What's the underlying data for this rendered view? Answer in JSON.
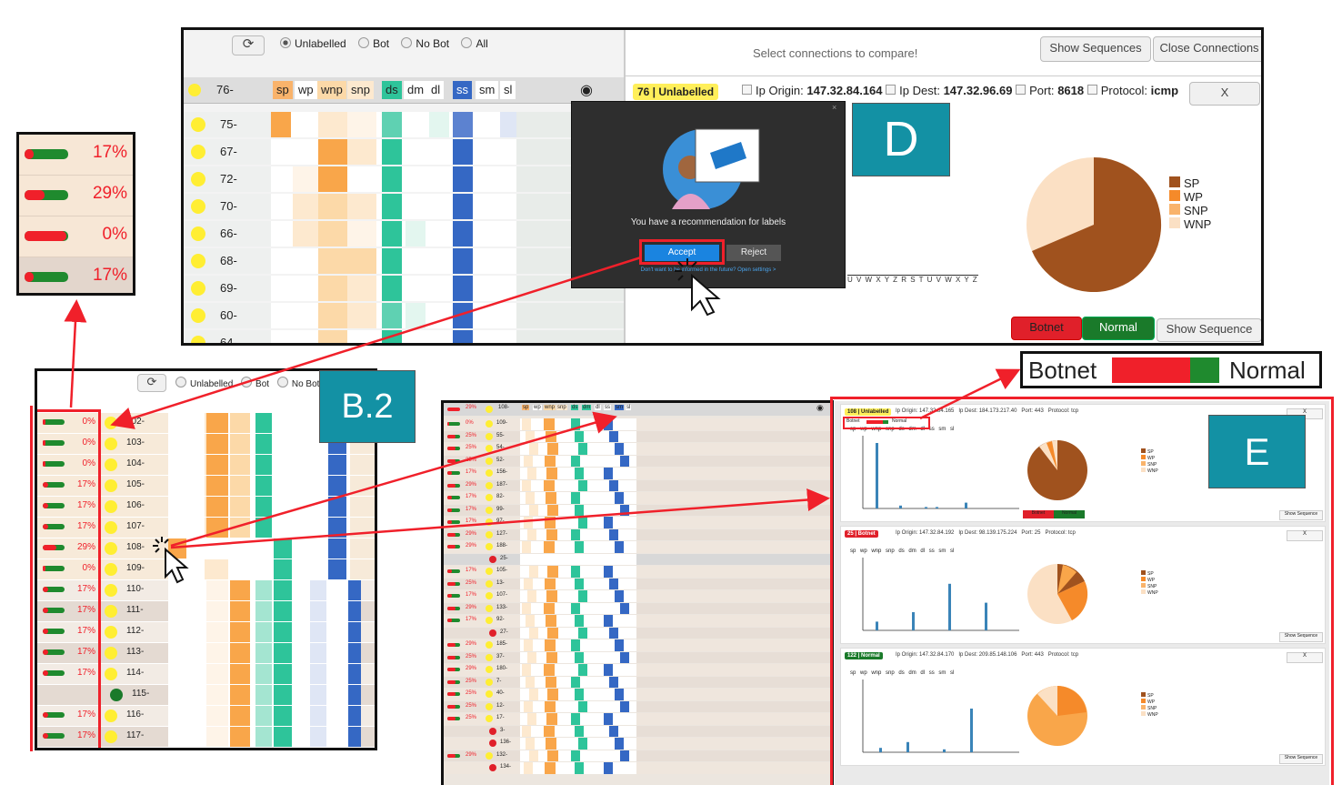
{
  "top_panel": {
    "refresh_icon": "refresh-icon",
    "filters": [
      {
        "label": "Unlabelled",
        "selected": true
      },
      {
        "label": "Bot",
        "selected": false
      },
      {
        "label": "No Bot",
        "selected": false
      },
      {
        "label": "All",
        "selected": false
      }
    ],
    "select_hint": "Select connections to compare!",
    "show_sequences_label": "Show Sequences",
    "close_connections_label": "Close Connections",
    "header_row_id": "76-",
    "header_tags": [
      "sp",
      "wp",
      "wnp",
      "snp",
      "ds",
      "dm",
      "dl",
      "ss",
      "sm",
      "sl"
    ],
    "rows": [
      "75-",
      "67-",
      "72-",
      "70-",
      "66-",
      "68-",
      "69-",
      "60-",
      "64-"
    ],
    "detail": {
      "badge": "76 | Unlabelled",
      "ip_origin_label": "Ip Origin:",
      "ip_origin": "147.32.84.164",
      "ip_dest_label": "Ip Dest:",
      "ip_dest": "147.32.96.69",
      "port_label": "Port:",
      "port": "8618",
      "protocol_label": "Protocol:",
      "protocol": "icmp",
      "close_label": "X",
      "legend": [
        "SP",
        "WP",
        "SNP",
        "WNP"
      ],
      "botnet_label": "Botnet",
      "normal_label": "Normal",
      "show_sequence_label": "Show Sequence",
      "axis_letters": "U V W X Y Z R S T U V W X Y Z"
    },
    "popup": {
      "message": "You have a recommendation for labels",
      "accept_label": "Accept",
      "reject_label": "Reject",
      "settings_text": "Don't want to be informed in the future? Open settings >",
      "close_icon": "close-icon"
    }
  },
  "callouts": {
    "d": "D",
    "b2": "B.2",
    "e": "E"
  },
  "zoom_bars": [
    {
      "pct": "17%",
      "red": 0.2
    },
    {
      "pct": "29%",
      "red": 0.45
    },
    {
      "pct": "0%",
      "red": 0.95
    },
    {
      "pct": "17%",
      "red": 0.2
    }
  ],
  "botnet_normal_legend": {
    "botnet": "Botnet",
    "normal": "Normal"
  },
  "panel_b2": {
    "filters": [
      "Unlabelled",
      "Bot",
      "No Bot"
    ],
    "rows": [
      {
        "pct": "0%",
        "id": "102-",
        "dot": "yellow"
      },
      {
        "pct": "0%",
        "id": "103-",
        "dot": "yellow"
      },
      {
        "pct": "0%",
        "id": "104-",
        "dot": "yellow"
      },
      {
        "pct": "17%",
        "id": "105-",
        "dot": "yellow"
      },
      {
        "pct": "17%",
        "id": "106-",
        "dot": "yellow"
      },
      {
        "pct": "17%",
        "id": "107-",
        "dot": "yellow"
      },
      {
        "pct": "29%",
        "id": "108-",
        "dot": "yellow"
      },
      {
        "pct": "0%",
        "id": "109-",
        "dot": "yellow"
      },
      {
        "pct": "17%",
        "id": "110-",
        "dot": "yellow"
      },
      {
        "pct": "17%",
        "id": "111-",
        "dot": "yellow"
      },
      {
        "pct": "17%",
        "id": "112-",
        "dot": "yellow"
      },
      {
        "pct": "17%",
        "id": "113-",
        "dot": "yellow"
      },
      {
        "pct": "17%",
        "id": "114-",
        "dot": "yellow"
      },
      {
        "pct": "",
        "id": "115-",
        "dot": "green"
      },
      {
        "pct": "17%",
        "id": "116-",
        "dot": "yellow"
      },
      {
        "pct": "17%",
        "id": "117-",
        "dot": "yellow"
      }
    ]
  },
  "panel_c": {
    "header": {
      "pct": "29%",
      "id": "108-",
      "tags": [
        "sp",
        "wp",
        "wnp",
        "snp",
        "ds",
        "dm",
        "dl",
        "ss",
        "sm",
        "sl"
      ]
    },
    "rows": [
      {
        "pct": "0%",
        "id": "109-",
        "dot": "yellow"
      },
      {
        "pct": "25%",
        "id": "55-",
        "dot": "yellow"
      },
      {
        "pct": "25%",
        "id": "54-",
        "dot": "yellow"
      },
      {
        "pct": "25%",
        "id": "52-",
        "dot": "yellow"
      },
      {
        "pct": "17%",
        "id": "156-",
        "dot": "yellow"
      },
      {
        "pct": "29%",
        "id": "187-",
        "dot": "yellow"
      },
      {
        "pct": "17%",
        "id": "82-",
        "dot": "yellow"
      },
      {
        "pct": "17%",
        "id": "99-",
        "dot": "yellow"
      },
      {
        "pct": "17%",
        "id": "97-",
        "dot": "yellow"
      },
      {
        "pct": "29%",
        "id": "127-",
        "dot": "yellow"
      },
      {
        "pct": "29%",
        "id": "188-",
        "dot": "yellow"
      },
      {
        "pct": "",
        "id": "25-",
        "dot": "red"
      },
      {
        "pct": "17%",
        "id": "105-",
        "dot": "yellow"
      },
      {
        "pct": "25%",
        "id": "13-",
        "dot": "yellow"
      },
      {
        "pct": "17%",
        "id": "107-",
        "dot": "yellow"
      },
      {
        "pct": "29%",
        "id": "133-",
        "dot": "yellow"
      },
      {
        "pct": "17%",
        "id": "92-",
        "dot": "yellow"
      },
      {
        "pct": "",
        "id": "27-",
        "dot": "red"
      },
      {
        "pct": "29%",
        "id": "185-",
        "dot": "yellow"
      },
      {
        "pct": "25%",
        "id": "37-",
        "dot": "yellow"
      },
      {
        "pct": "29%",
        "id": "180-",
        "dot": "yellow"
      },
      {
        "pct": "25%",
        "id": "7-",
        "dot": "yellow"
      },
      {
        "pct": "25%",
        "id": "40-",
        "dot": "yellow"
      },
      {
        "pct": "25%",
        "id": "12-",
        "dot": "yellow"
      },
      {
        "pct": "25%",
        "id": "17-",
        "dot": "yellow"
      },
      {
        "pct": "",
        "id": "3-",
        "dot": "red"
      },
      {
        "pct": "",
        "id": "136-",
        "dot": "red"
      },
      {
        "pct": "29%",
        "id": "132-",
        "dot": "yellow"
      },
      {
        "pct": "",
        "id": "134-",
        "dot": "red"
      }
    ]
  },
  "panel_e": [
    {
      "badge": "108 | Unlabelled",
      "badge_color": "#ffef5a",
      "badge_text": "#222",
      "info": "Ip Origin: 147.32.84.165   Ip Dest: 184.173.217.40   Port: 443   Protocol: tcp",
      "pie": "brown",
      "show_seq": "Show Sequence",
      "close": "X"
    },
    {
      "badge": "25 | Botnet",
      "badge_color": "#e0202a",
      "badge_text": "#fff",
      "info": "Ip Origin: 147.32.84.192   Ip Dest: 98.139.175.224   Port: 25   Protocol: tcp",
      "pie": "mixed",
      "show_seq": "Show Sequence",
      "close": "X"
    },
    {
      "badge": "122 | Normal",
      "badge_color": "#1a7a2a",
      "badge_text": "#fff",
      "info": "Ip Origin: 147.32.84.170   Ip Dest: 209.85.148.106   Port: 443   Protocol: tcp",
      "pie": "light",
      "show_seq": "Show Sequence",
      "close": "X"
    }
  ],
  "panel_e_legend": [
    "SP",
    "WP",
    "SNP",
    "WNP"
  ],
  "panel_e_tags": "sp wp wnp snp ds dm dl ss sm sl",
  "mini_botnet": "Botnet",
  "mini_normal": "Normal",
  "colors": {
    "sp": "#f9a64a",
    "wnp": "#fcd9a8",
    "ds": "#2ec49a",
    "ss": "#3568c4",
    "red": "#f0202a",
    "green": "#1f8a2e",
    "callout": "#1391a4",
    "brown": "#a0521e"
  }
}
